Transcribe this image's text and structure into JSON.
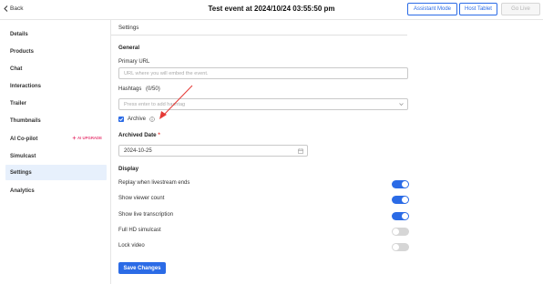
{
  "header": {
    "back_label": "Back",
    "title": "Test event at 2024/10/24 03:55:50 pm",
    "assistant_mode_label": "Assistant Mode",
    "host_tablet_label": "Host Tablet",
    "go_live_label": "Go Live"
  },
  "sidebar": {
    "items": [
      {
        "label": "Details"
      },
      {
        "label": "Products"
      },
      {
        "label": "Chat"
      },
      {
        "label": "Interactions"
      },
      {
        "label": "Trailer"
      },
      {
        "label": "Thumbnails"
      },
      {
        "label": "AI Co-pilot"
      },
      {
        "label": "Simulcast"
      },
      {
        "label": "Settings"
      },
      {
        "label": "Analytics"
      }
    ],
    "active_item": "Settings",
    "ai_badge": "AI UPGRADE"
  },
  "settings": {
    "heading": "Settings",
    "general_title": "General",
    "primary_url_label": "Primary URL",
    "primary_url_placeholder": "URL where you will embed the event.",
    "primary_url_value": "",
    "hashtags_label": "Hashtags",
    "hashtags_count": "(0/50)",
    "hashtags_placeholder": "Press enter to add hashtag",
    "archive_label": "Archive",
    "archive_checked": true,
    "archived_date_label": "Archived Date",
    "required_mark": "*",
    "archived_date_value": "2024-10-25",
    "display_title": "Display",
    "display_options": [
      {
        "label": "Replay when livestream ends",
        "enabled": true
      },
      {
        "label": "Show viewer count",
        "enabled": true
      },
      {
        "label": "Show live transcription",
        "enabled": true
      },
      {
        "label": "Full HD simulcast",
        "enabled": false
      },
      {
        "label": "Lock video",
        "enabled": false
      }
    ],
    "save_label": "Save Changes"
  },
  "colors": {
    "accent": "#2b6be6",
    "active_bg": "#e7f0fc",
    "badge": "#e8477a",
    "annotation_arrow": "#e53935"
  },
  "icons": {
    "back": "chevron-left-icon",
    "archive_info": "info-icon",
    "date": "calendar-icon",
    "hashtag_select": "chevron-down-icon",
    "ai_badge": "sparkle-icon"
  }
}
